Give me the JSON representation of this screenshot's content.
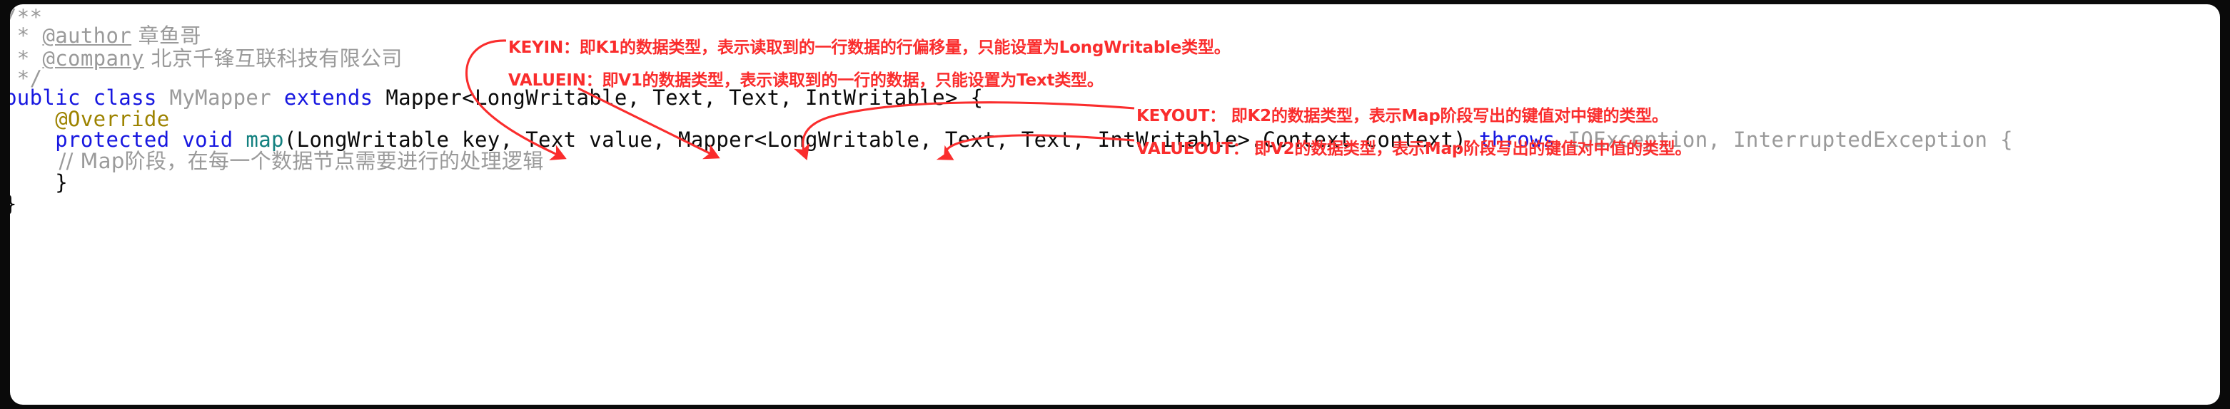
{
  "card": {
    "background": "#ffffff",
    "outer_background": "#0a0a0a"
  },
  "colors": {
    "keyword": "#1717e0",
    "type_gray": "#9a9a9a",
    "comment_gray": "#9a9a9a",
    "method_teal": "#12807f",
    "annotation_olive": "#9d8300",
    "plain_black": "#0a0a0a",
    "note_red": "#fa2d2d"
  },
  "code": {
    "line1": {
      "text": "/**"
    },
    "line2": {
      "star": " * ",
      "tag": "@author",
      "value": " 章鱼哥"
    },
    "line3": {
      "star": " * ",
      "tag": "@company",
      "value": " 北京千锋互联科技有限公司"
    },
    "line4": {
      "text": " */"
    },
    "line5": {
      "kw1": "public class ",
      "classname": "MyMapper",
      "kw2": " extends ",
      "generic": "Mapper<LongWritable, Text, Text, IntWritable> {"
    },
    "line6": {
      "annotation": "    @Override"
    },
    "line7": {
      "kw1": "    protected void ",
      "method": "map",
      "params": "(LongWritable key, Text value, Mapper<LongWritable, Text, Text, IntWritable>.Context context) ",
      "kw2": "throws ",
      "exceptions": "IOException, InterruptedException {"
    },
    "line8": {
      "comment": "        // Map阶段，在每一个数据节点需要进行的处理逻辑"
    },
    "line9": {
      "text": "    }"
    },
    "line10": {
      "text": "}"
    }
  },
  "annotations": {
    "keyin": "KEYIN：即K1的数据类型，表示读取到的一行数据的行偏移量，只能设置为LongWritable类型。",
    "valuein": "VALUEIN：即V1的数据类型，表示读取到的一行的数据，只能设置为Text类型。",
    "keyout": "KEYOUT： 即K2的数据类型，表示Map阶段写出的键值对中键的类型。",
    "valueout": "VALUEOUT： 即V2的数据类型，表示Map阶段写出的键值对中值的类型。"
  },
  "arrow_targets": {
    "keyin": "LongWritable",
    "valuein": "Text",
    "keyout": "Text",
    "valueout": "IntWritable"
  }
}
